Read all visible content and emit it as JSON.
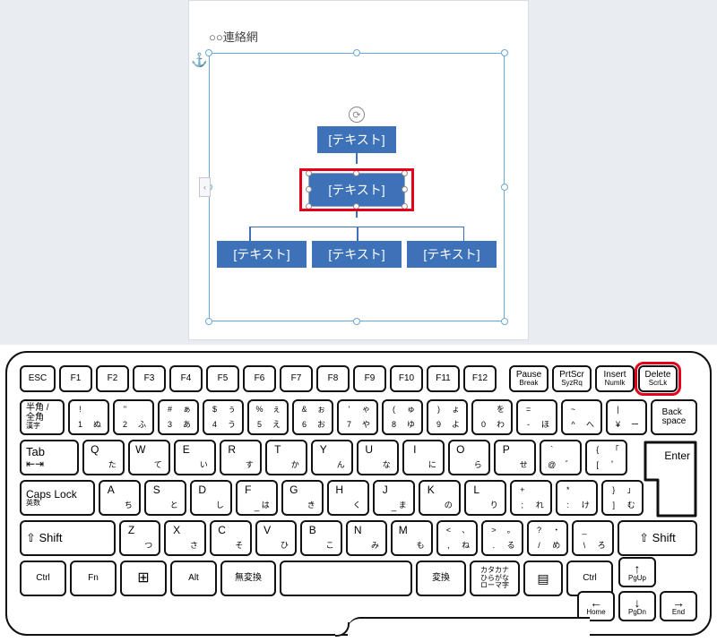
{
  "document": {
    "title": "○○連絡網",
    "anchor_glyph": "⚓",
    "nodes": {
      "top": "[テキスト]",
      "mid": "[テキスト]",
      "bottom": [
        "[テキスト]",
        "[テキスト]",
        "[テキスト]"
      ]
    },
    "insert_tab": "‹"
  },
  "keyboard": {
    "row0": [
      "ESC",
      "F1",
      "F2",
      "F3",
      "F4",
      "F5",
      "F6",
      "F7",
      "F8",
      "F9",
      "F10",
      "F11",
      "F12"
    ],
    "row0_right": [
      {
        "top": "Pause",
        "bot": "Break"
      },
      {
        "top": "PrtScr",
        "bot": "SyzRq"
      },
      {
        "top": "Insert",
        "bot": "Numlk"
      },
      {
        "top": "Delete",
        "bot": "ScrLk"
      }
    ],
    "row1_first": {
      "l1": "半角 /",
      "l2": "全角",
      "l3": "漢字"
    },
    "row1": [
      {
        "tl": "!",
        "tr": "",
        "bl": "1",
        "br": "ぬ"
      },
      {
        "tl": "\"",
        "tr": "",
        "bl": "2",
        "br": "ふ"
      },
      {
        "tl": "#",
        "tr": "ぁ",
        "bl": "3",
        "br": "あ"
      },
      {
        "tl": "$",
        "tr": "ぅ",
        "bl": "4",
        "br": "う"
      },
      {
        "tl": "%",
        "tr": "ぇ",
        "bl": "5",
        "br": "え"
      },
      {
        "tl": "&",
        "tr": "ぉ",
        "bl": "6",
        "br": "お"
      },
      {
        "tl": "'",
        "tr": "ゃ",
        "bl": "7",
        "br": "や"
      },
      {
        "tl": "(",
        "tr": "ゅ",
        "bl": "8",
        "br": "ゆ"
      },
      {
        "tl": ")",
        "tr": "ょ",
        "bl": "9",
        "br": "よ"
      },
      {
        "tl": "",
        "tr": "を",
        "bl": "0",
        "br": "わ"
      },
      {
        "tl": "=",
        "tr": "",
        "bl": "-",
        "br": "ほ"
      },
      {
        "tl": "~",
        "tr": "",
        "bl": "^",
        "br": "へ"
      },
      {
        "tl": "|",
        "tr": "",
        "bl": "¥",
        "br": "ー"
      }
    ],
    "backspace": "Back\nspace",
    "tab": "Tab",
    "row2": [
      {
        "t": "Q",
        "b": "た"
      },
      {
        "t": "W",
        "b": "て"
      },
      {
        "t": "E",
        "b": "い"
      },
      {
        "t": "R",
        "b": "す"
      },
      {
        "t": "T",
        "b": "か"
      },
      {
        "t": "Y",
        "b": "ん"
      },
      {
        "t": "U",
        "b": "な"
      },
      {
        "t": "I",
        "b": "に"
      },
      {
        "t": "O",
        "b": "ら"
      },
      {
        "t": "P",
        "b": "せ"
      },
      {
        "tl": "`",
        "tr": "",
        "bl": "@",
        "br": "゛"
      },
      {
        "tl": "{",
        "tr": "「",
        "bl": "[",
        "br": "゜"
      }
    ],
    "enter": "Enter",
    "caps": {
      "l1": "Caps Lock",
      "l2": "英数"
    },
    "row3": [
      {
        "t": "A",
        "b": "ち"
      },
      {
        "t": "S",
        "b": "と"
      },
      {
        "t": "D",
        "b": "し"
      },
      {
        "t": "F",
        "b": "は"
      },
      {
        "t": "G",
        "b": "き"
      },
      {
        "t": "H",
        "b": "く"
      },
      {
        "t": "J",
        "b": "ま"
      },
      {
        "t": "K",
        "b": "の"
      },
      {
        "t": "L",
        "b": "り"
      },
      {
        "tl": "+",
        "tr": "",
        "bl": ";",
        "br": "れ"
      },
      {
        "tl": "*",
        "tr": "",
        "bl": ":",
        "br": "け"
      },
      {
        "tl": "}",
        "tr": "」",
        "bl": "]",
        "br": "む"
      }
    ],
    "shift": "⇧ Shift",
    "row4": [
      {
        "t": "Z",
        "b": "つ"
      },
      {
        "t": "X",
        "b": "さ"
      },
      {
        "t": "C",
        "b": "そ"
      },
      {
        "t": "V",
        "b": "ひ"
      },
      {
        "t": "B",
        "b": "こ"
      },
      {
        "t": "N",
        "b": "み"
      },
      {
        "t": "M",
        "b": "も"
      },
      {
        "tl": "<",
        "tr": "、",
        "bl": ",",
        "br": "ね"
      },
      {
        "tl": ">",
        "tr": "。",
        "bl": ".",
        "br": "る"
      },
      {
        "tl": "?",
        "tr": "・",
        "bl": "/",
        "br": "め"
      },
      {
        "tl": "_",
        "tr": "",
        "bl": "\\",
        "br": "ろ"
      }
    ],
    "row5": {
      "ctrl": "Ctrl",
      "fn": "Fn",
      "win": "⊞",
      "alt": "Alt",
      "muhenkan": "無変換",
      "space": "",
      "henkan": "変換",
      "kana": "カタカナ\nひらがな\nローマ字",
      "menu": "▤",
      "ctrl2": "Ctrl"
    },
    "arrows": {
      "up": {
        "a": "↑",
        "s": "PgUp"
      },
      "left": {
        "a": "←",
        "s": "Home"
      },
      "down": {
        "a": "↓",
        "s": "PgDn"
      },
      "right": {
        "a": "→",
        "s": "End"
      }
    },
    "f_underline": "_"
  }
}
